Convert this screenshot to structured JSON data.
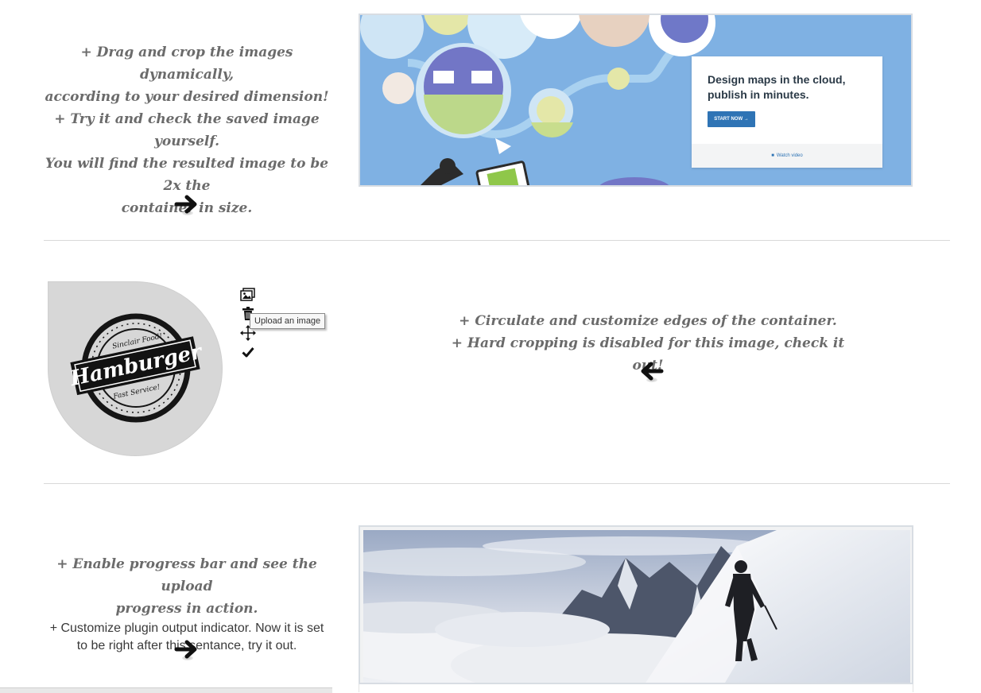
{
  "section1": {
    "lines": [
      "+ Drag and crop the images dynamically,",
      "according to your desired dimension!",
      "+ Try it and check the saved image yourself.",
      "You will find the resulted image to be 2x the",
      "container in size."
    ],
    "arrow_icon": "arrow-right-icon",
    "card": {
      "title": "Design maps in the cloud, publish in minutes.",
      "button": "START NOW →",
      "video_link": "Watch video"
    }
  },
  "section2": {
    "logo": {
      "top": "Sinclair Food!",
      "main": "Hamburger",
      "bottom": "Fast Service!"
    },
    "tools": [
      "upload-image-icon",
      "trash-icon",
      "move-icon",
      "check-icon"
    ],
    "tooltip": "Upload an image",
    "lines": [
      "+ Circulate and customize edges of the container.",
      "+ Hard cropping is disabled for this image, check it out!"
    ],
    "arrow_icon": "arrow-left-icon"
  },
  "section3": {
    "script_lines": [
      "+ Enable progress bar and see the upload",
      "progress in action."
    ],
    "plain_lines": [
      "+ Customize plugin output indicator. Now it is set",
      "to be right after this sentance, try it out."
    ],
    "arrow_icon": "arrow-right-icon"
  },
  "colors": {
    "text": "#6b6b6b",
    "map_bg": "#7fb1e3",
    "button": "#2f74b5",
    "circle": "#d7d7d7"
  }
}
